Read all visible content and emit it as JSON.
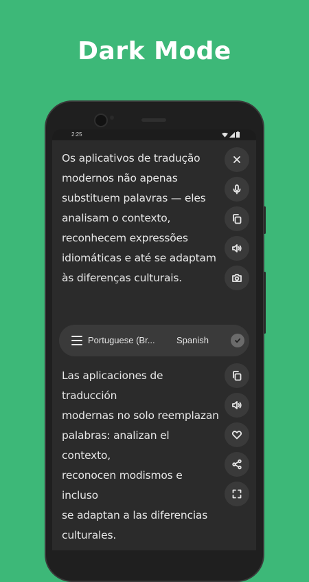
{
  "headline": "Dark Mode",
  "status": {
    "time": "2:25"
  },
  "source": {
    "lines": [
      "Os aplicativos de tradução",
      "modernos não apenas",
      "substituem palavras — eles",
      "analisam o contexto,",
      "reconhecem expressões",
      "idiomáticas e até se adaptam",
      "às diferenças culturais."
    ]
  },
  "language_bar": {
    "source_language": "Portuguese (Br...",
    "target_language": "Spanish"
  },
  "translation": {
    "lines": [
      "Las aplicaciones de traducción",
      "modernas no solo reemplazan",
      "palabras: analizan el contexto,",
      "reconocen modismos e incluso",
      "se adaptan a las diferencias",
      "culturales."
    ]
  },
  "icons": {
    "source_actions": [
      "close-icon",
      "microphone-icon",
      "copy-icon",
      "speaker-icon",
      "camera-icon"
    ],
    "translation_actions": [
      "copy-icon",
      "speaker-icon",
      "heart-icon",
      "share-icon",
      "fullscreen-icon"
    ],
    "language_bar": [
      "menu-icon",
      "check-icon"
    ]
  },
  "colors": {
    "background": "#3db878",
    "screen": "#2b2b2b",
    "button": "#3a3a3a",
    "text": "#e6e6e6"
  }
}
